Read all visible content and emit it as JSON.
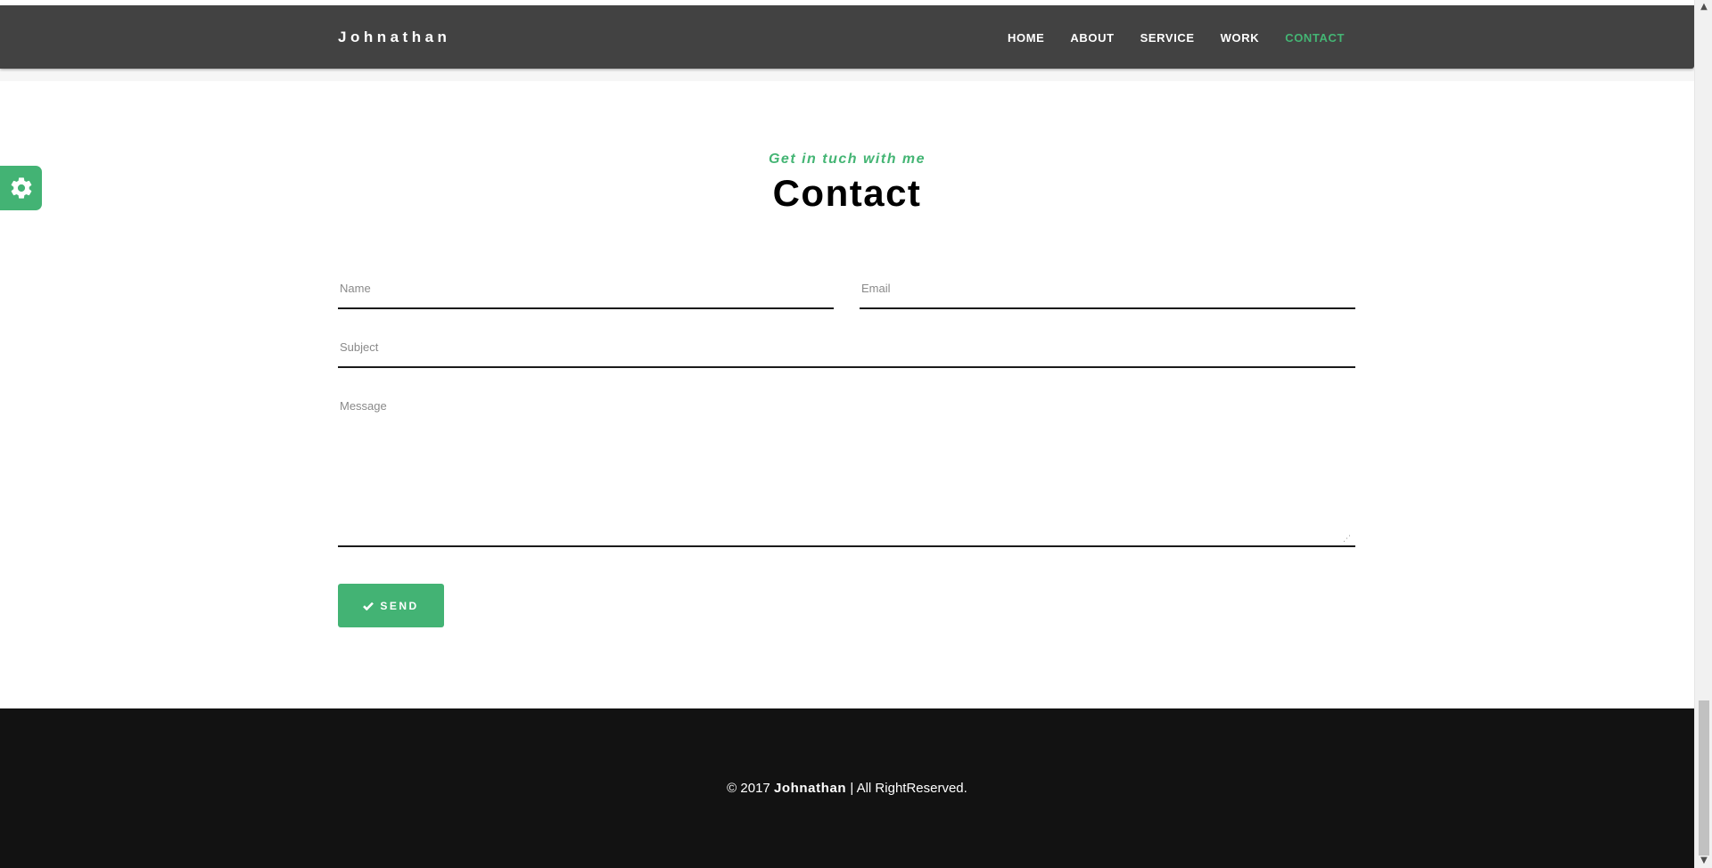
{
  "header": {
    "brand": "Johnathan",
    "nav": [
      {
        "label": "HOME"
      },
      {
        "label": "ABOUT"
      },
      {
        "label": "SERVICE"
      },
      {
        "label": "WORK"
      },
      {
        "label": "CONTACT",
        "active": true
      }
    ]
  },
  "settings": {
    "icon": "gear-icon"
  },
  "contact": {
    "subtitle": "Get in tuch with me",
    "title": "Contact",
    "form": {
      "name_placeholder": "Name",
      "email_placeholder": "Email",
      "subject_placeholder": "Subject",
      "message_placeholder": "Message",
      "send_label": "SEND",
      "send_icon": "check-icon"
    }
  },
  "footer": {
    "copyright": "© 2017",
    "name": "Johnathan",
    "rights": "| All RightReserved."
  },
  "colors": {
    "accent": "#43b374",
    "header_bg": "#424242",
    "footer_bg": "#121212"
  }
}
